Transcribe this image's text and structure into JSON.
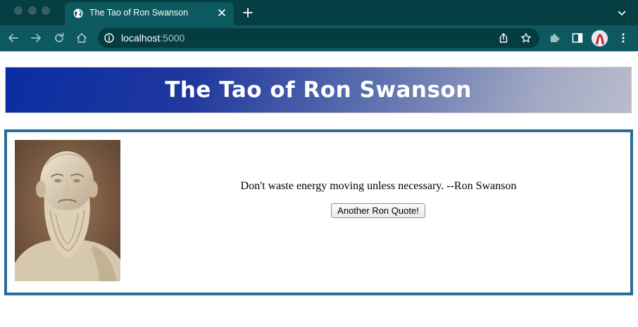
{
  "browser": {
    "tab": {
      "title": "The Tao of Ron Swanson",
      "favicon": "globe-icon"
    },
    "address": {
      "host": "localhost",
      "port": ":5000"
    },
    "icons": [
      "back-icon",
      "forward-icon",
      "reload-icon",
      "home-icon",
      "info-icon",
      "share-icon",
      "star-icon",
      "extensions-icon",
      "sidepanel-icon",
      "profile-avatar",
      "menu-icon"
    ],
    "colors": {
      "tabbar": "#053f43",
      "toolbar": "#0c5a5f",
      "omnibox": "#043c40"
    }
  },
  "page": {
    "title": "The Tao of Ron Swanson",
    "quote": "Don't waste energy moving unless necessary. --Ron Swanson",
    "button_label": "Another Ron Quote!",
    "image_alt": "socrates-bust",
    "colors": {
      "header_start": "#0a2da3",
      "header_end": "#b8bccb",
      "box_border": "#2a6c9a"
    }
  }
}
